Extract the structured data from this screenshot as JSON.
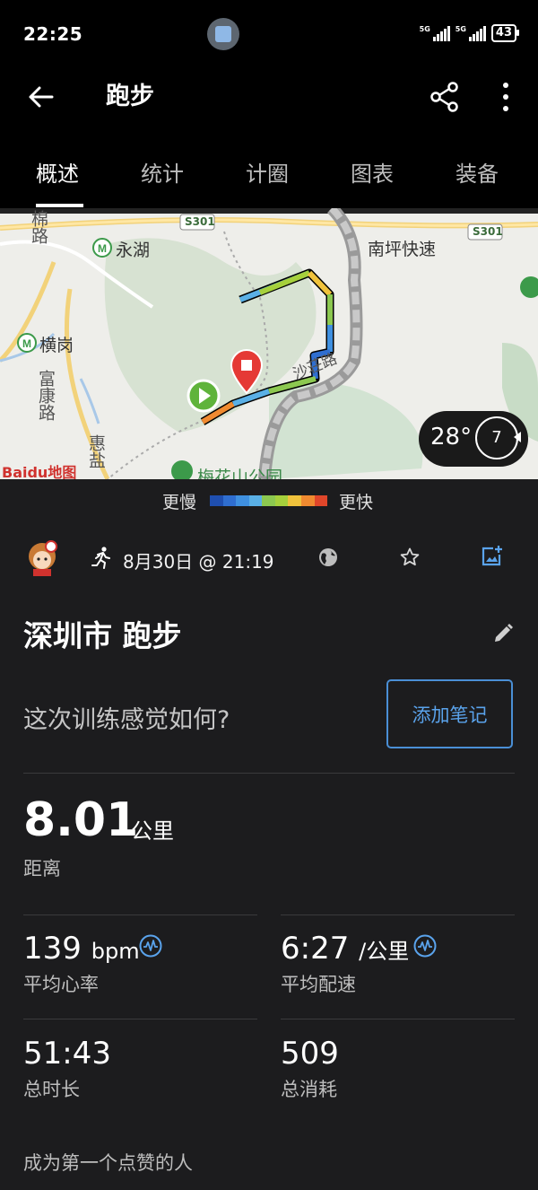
{
  "status_bar": {
    "time": "22:25",
    "network1": "5G",
    "network2": "5G",
    "battery": "43"
  },
  "app_bar": {
    "title": "跑步",
    "back_icon": "arrow-left-icon",
    "share_icon": "share-icon",
    "more_icon": "more-vertical-icon"
  },
  "tabs": [
    {
      "label": "概述",
      "active": true
    },
    {
      "label": "统计",
      "active": false
    },
    {
      "label": "计圈",
      "active": false
    },
    {
      "label": "图表",
      "active": false
    },
    {
      "label": "装备",
      "active": false
    }
  ],
  "map": {
    "labels": {
      "s301_a": "S301",
      "s301_b": "S301",
      "yonghu": "永湖",
      "nanping": "南坪快速",
      "mianlu": "棉路",
      "henggang": "横岗",
      "fukang": "富康路",
      "huiyan": "惠盐",
      "shazhuang": "沙荘路",
      "meihuashan": "梅花山公园",
      "baidu": "Baidu地图"
    },
    "weather": {
      "temp": "28°",
      "wind": "7"
    }
  },
  "pace_legend": {
    "slow": "更慢",
    "fast": "更快",
    "colors": [
      "#1f4fb0",
      "#2f6ed0",
      "#3f90e0",
      "#5ab0e6",
      "#8cc850",
      "#a6d03c",
      "#f0c23c",
      "#f08a30",
      "#e0462a"
    ]
  },
  "activity": {
    "date": "8月30日 @ 21:19",
    "title": "深圳市 跑步",
    "feel_question": "这次训练感觉如何?",
    "add_note": "添加笔记"
  },
  "stats": {
    "distance": {
      "value": "8.01",
      "unit": "公里",
      "label": "距离"
    },
    "avg_hr": {
      "value": "139",
      "unit": "bpm",
      "label": "平均心率"
    },
    "avg_pace": {
      "value": "6:27",
      "unit": "/公里",
      "label": "平均配速"
    },
    "duration": {
      "value": "51:43",
      "label": "总时长"
    },
    "calories": {
      "value": "509",
      "label": "总消耗"
    }
  },
  "likes_text": "成为第一个点赞的人",
  "accent": "#5aa3ec"
}
